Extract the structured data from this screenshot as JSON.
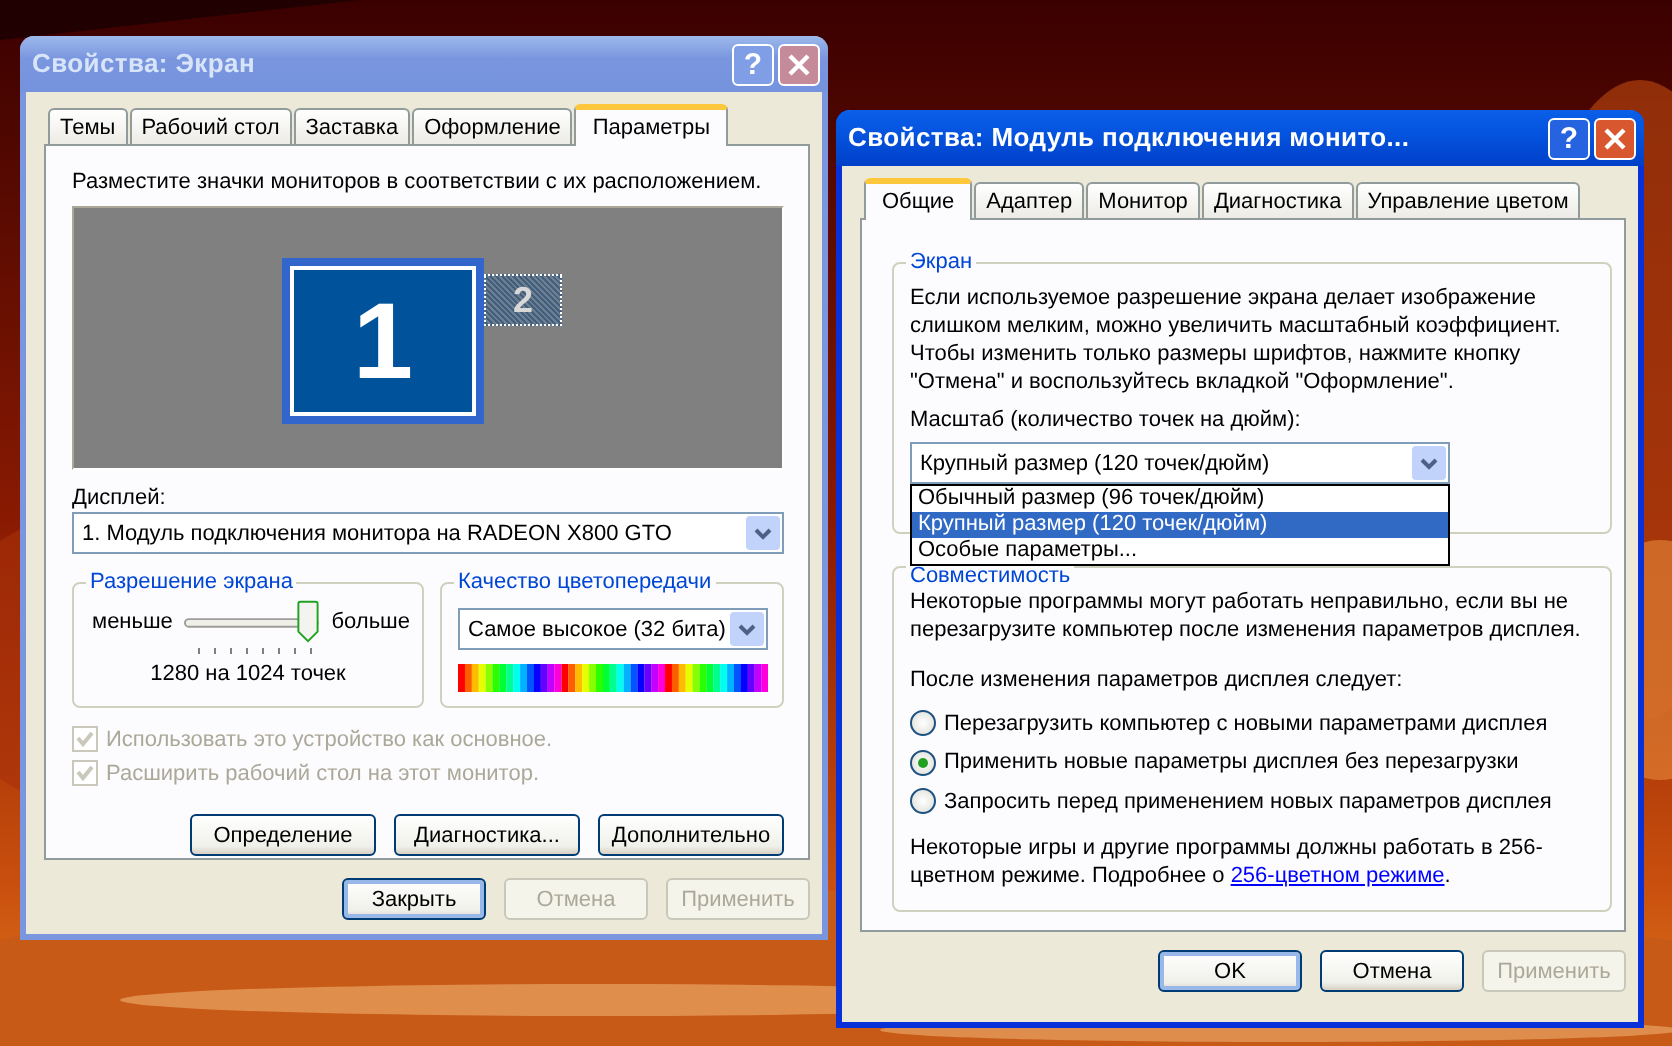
{
  "display_properties": {
    "title": "Свойства: Экран",
    "active": false,
    "help_button": "?",
    "tabs": [
      {
        "label": "Темы",
        "selected": false
      },
      {
        "label": "Рабочий стол",
        "selected": false
      },
      {
        "label": "Заставка",
        "selected": false
      },
      {
        "label": "Оформление",
        "selected": false
      },
      {
        "label": "Параметры",
        "selected": true
      }
    ],
    "instruction": "Разместите значки мониторов в соответствии с их расположением.",
    "monitors": [
      {
        "label": "1",
        "selected": true
      },
      {
        "label": "2",
        "selected": false
      }
    ],
    "display_label": "Дисплей:",
    "display_value": "1. Модуль подключения монитора на RADEON X800 GTO",
    "resolution": {
      "legend": "Разрешение экрана",
      "less": "меньше",
      "more": "больше",
      "level": 1,
      "reading": "1280 на 1024 точек"
    },
    "color_quality": {
      "legend": "Качество цветопередачи",
      "value": "Самое высокое (32 бита)"
    },
    "checkboxes": [
      {
        "label": "Использовать это устройство как основное.",
        "checked": true,
        "disabled": true
      },
      {
        "label": "Расширить рабочий стол на этот монитор.",
        "checked": true,
        "disabled": true
      }
    ],
    "buttons": [
      {
        "label": "Определение",
        "default": false,
        "disabled": false
      },
      {
        "label": "Диагностика...",
        "default": false,
        "disabled": false
      },
      {
        "label": "Дополнительно",
        "default": false,
        "disabled": false
      }
    ],
    "footer_buttons": [
      {
        "label": "Закрыть",
        "default": true,
        "disabled": false
      },
      {
        "label": "Отмена",
        "default": false,
        "disabled": true
      },
      {
        "label": "Применить",
        "default": false,
        "disabled": true
      }
    ]
  },
  "monitor_properties": {
    "title": "Свойства: Модуль подключения монито...",
    "active": true,
    "help_button": "?",
    "tabs": [
      {
        "label": "Общие",
        "selected": true
      },
      {
        "label": "Адаптер",
        "selected": false
      },
      {
        "label": "Монитор",
        "selected": false
      },
      {
        "label": "Диагностика",
        "selected": false
      },
      {
        "label": "Управление цветом",
        "selected": false
      }
    ],
    "screen_group": {
      "legend": "Экран",
      "text": "Если используемое разрешение экрана делает изображение слишком мелким, можно увеличить масштабный коэффициент. Чтобы изменить только размеры шрифтов, нажмите кнопку \"Отмена\" и воспользуйтесь вкладкой \"Оформление\".",
      "scale_label": "Масштаб (количество точек на дюйм):",
      "scale_value": "Крупный размер (120 точек/дюйм)",
      "scale_options": [
        {
          "label": "Обычный размер (96 точек/дюйм)",
          "selected": false
        },
        {
          "label": "Крупный размер (120 точек/дюйм)",
          "selected": true
        },
        {
          "label": "Особые параметры...",
          "selected": false
        }
      ]
    },
    "compat_group": {
      "legend": "Совместимость",
      "text": "Некоторые программы могут работать неправильно, если вы не перезагрузите компьютер после изменения параметров дисплея.",
      "radio_label": "После изменения параметров дисплея следует:",
      "radios": [
        {
          "label": "Перезагрузить компьютер с новыми параметрами дисплея",
          "selected": false
        },
        {
          "label": "Применить новые параметры дисплея без перезагрузки",
          "selected": true
        },
        {
          "label": "Запросить перед применением новых параметров дисплея",
          "selected": false
        }
      ],
      "note": "Некоторые игры и другие программы должны работать в 256-цветном режиме. Подробнее о ",
      "note_link": "256-цветном режиме",
      "note_end": "."
    },
    "footer_buttons": [
      {
        "label": "OK",
        "default": true,
        "disabled": false
      },
      {
        "label": "Отмена",
        "default": false,
        "disabled": false
      },
      {
        "label": "Применить",
        "default": false,
        "disabled": true
      }
    ]
  }
}
